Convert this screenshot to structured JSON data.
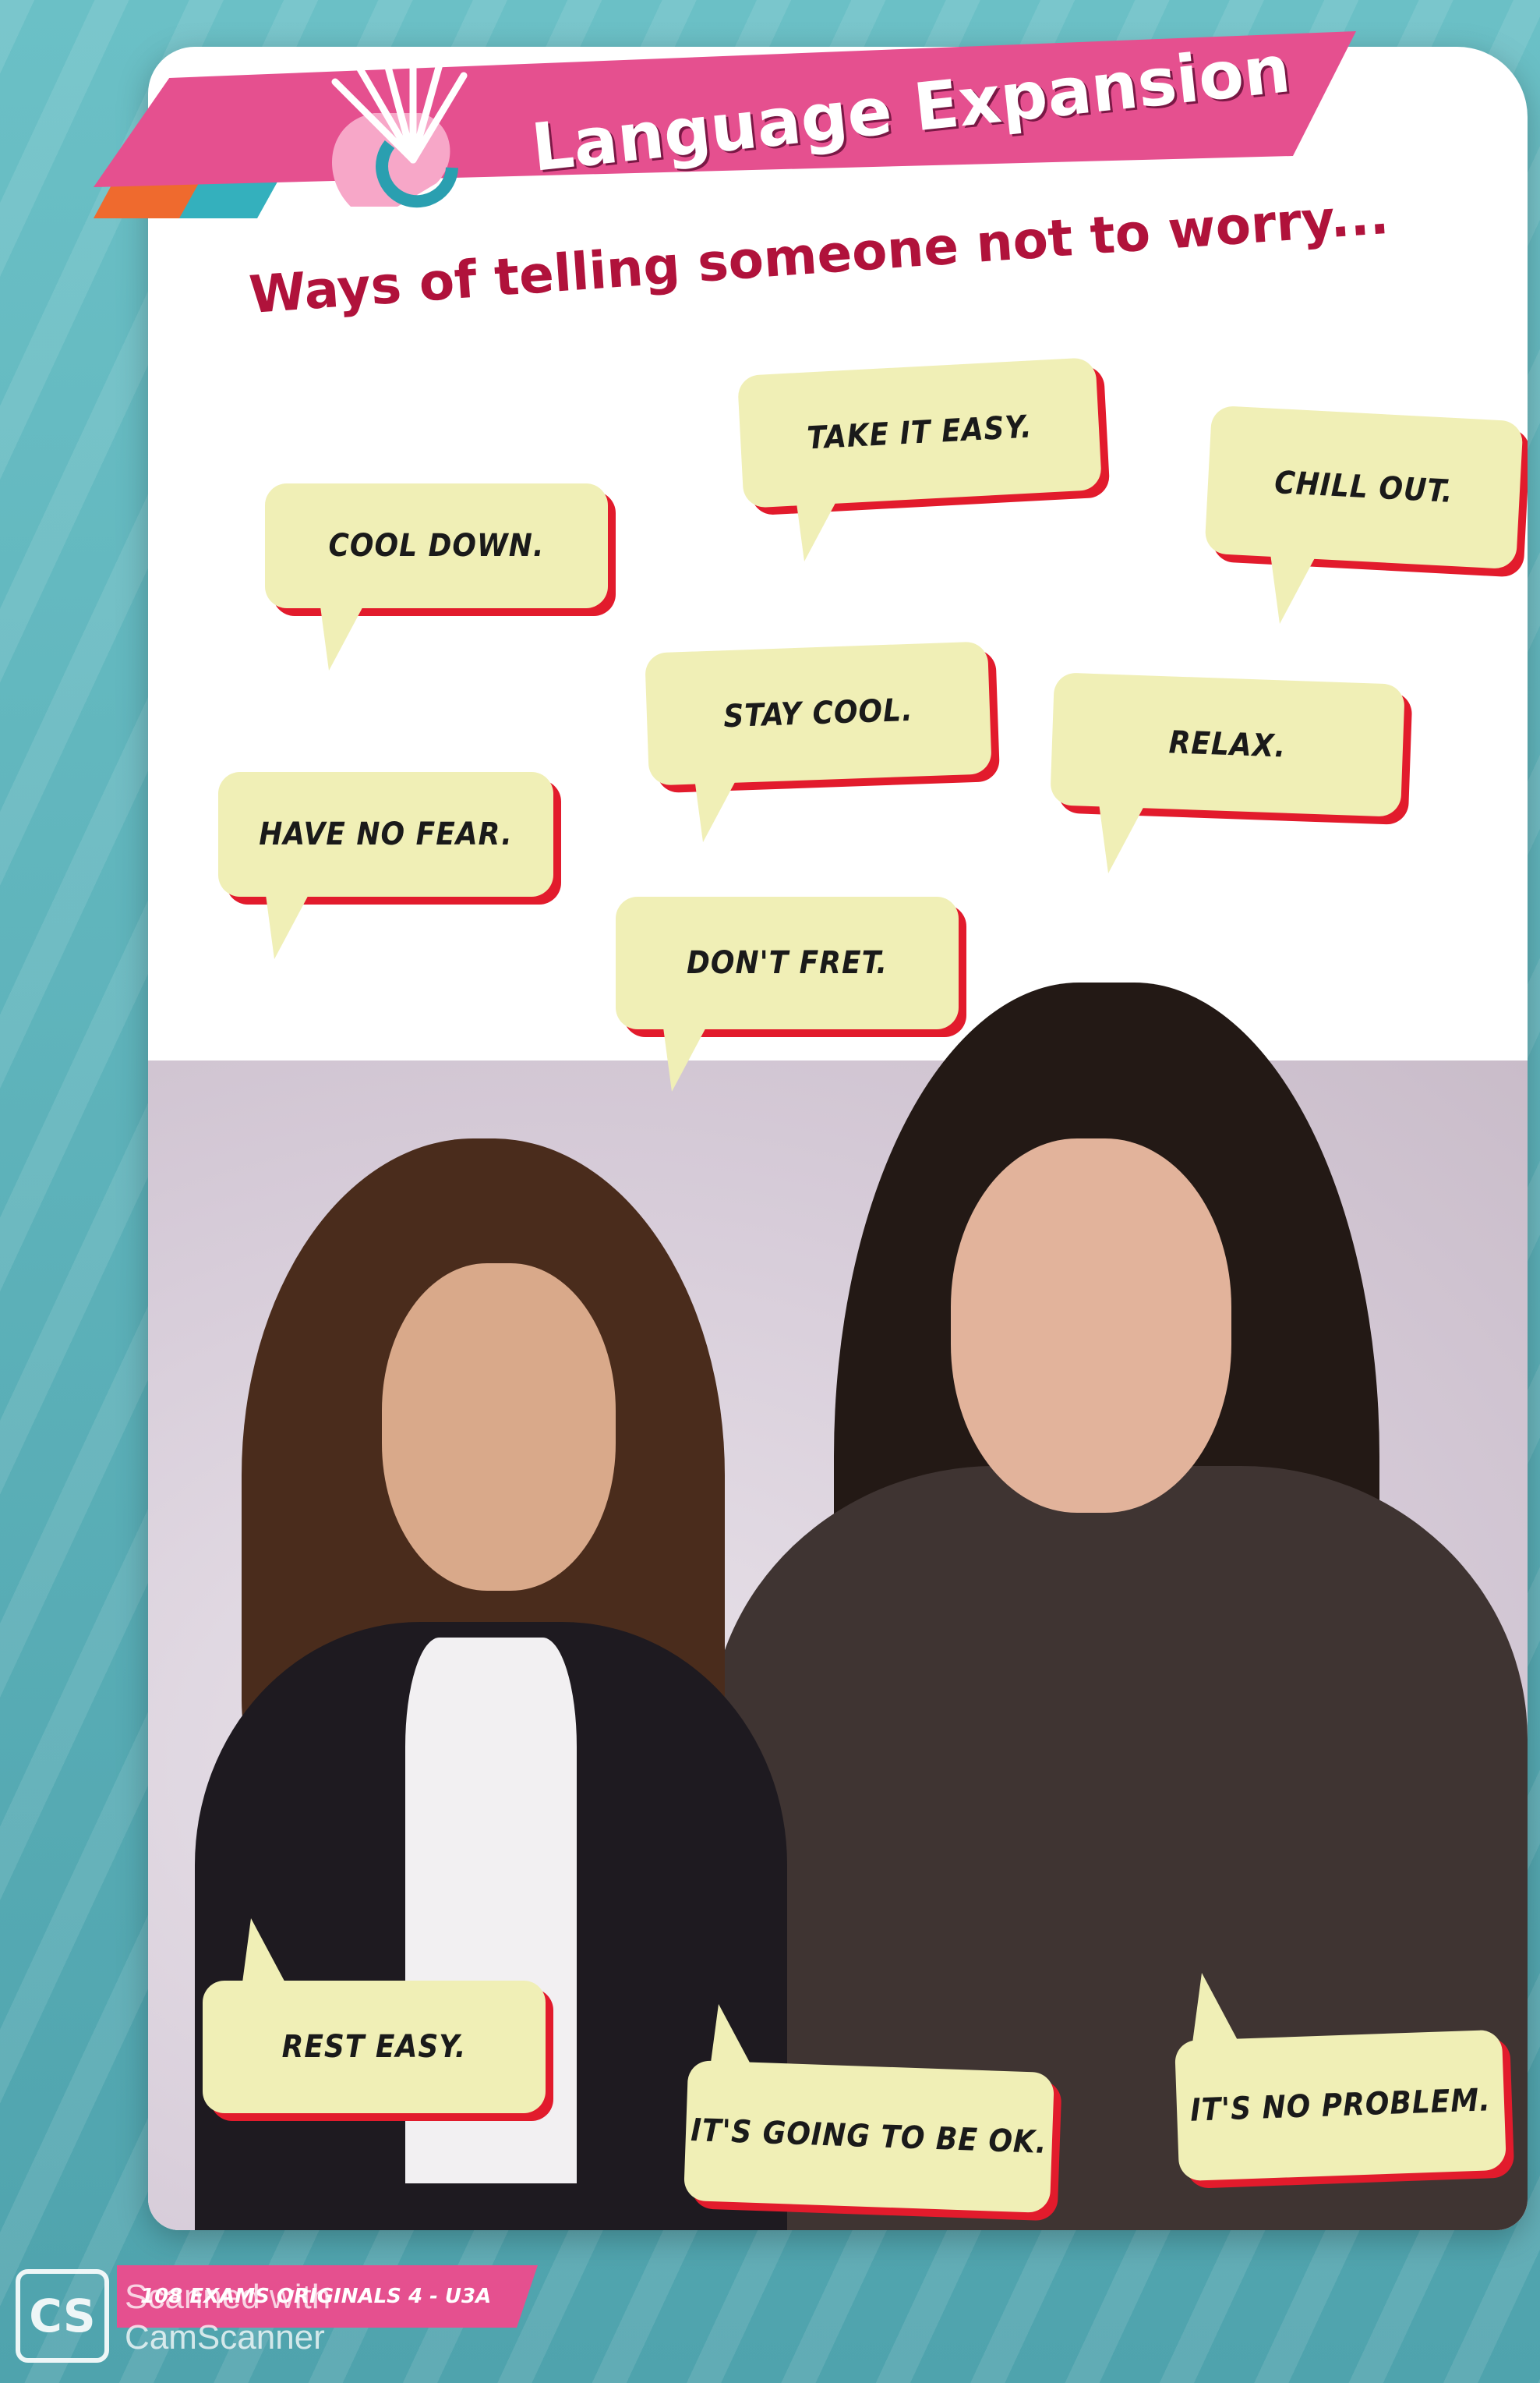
{
  "header": {
    "title": "Language Expansion"
  },
  "heading": "Ways of telling someone not to worry...",
  "bubbles": [
    {
      "text": "TAKE IT EASY."
    },
    {
      "text": "CHILL OUT."
    },
    {
      "text": "COOL DOWN."
    },
    {
      "text": "STAY COOL."
    },
    {
      "text": "RELAX."
    },
    {
      "text": "HAVE NO FEAR."
    },
    {
      "text": "DON'T FRET."
    },
    {
      "text": "REST EASY."
    },
    {
      "text": "IT'S GOING TO BE OK."
    },
    {
      "text": "IT'S NO PROBLEM."
    }
  ],
  "footer": {
    "page_label": "108 EXAMS ORIGINALS 4 - U3A"
  },
  "watermark": {
    "badge": "CS",
    "line1": "Scanned with",
    "line2": "CamScanner"
  },
  "colors": {
    "banner": "#e5508f",
    "heading": "#b0123b",
    "bubble_fill": "#f0efb6",
    "bubble_shadow": "#e21b2c",
    "background": "#5fb3bb"
  }
}
